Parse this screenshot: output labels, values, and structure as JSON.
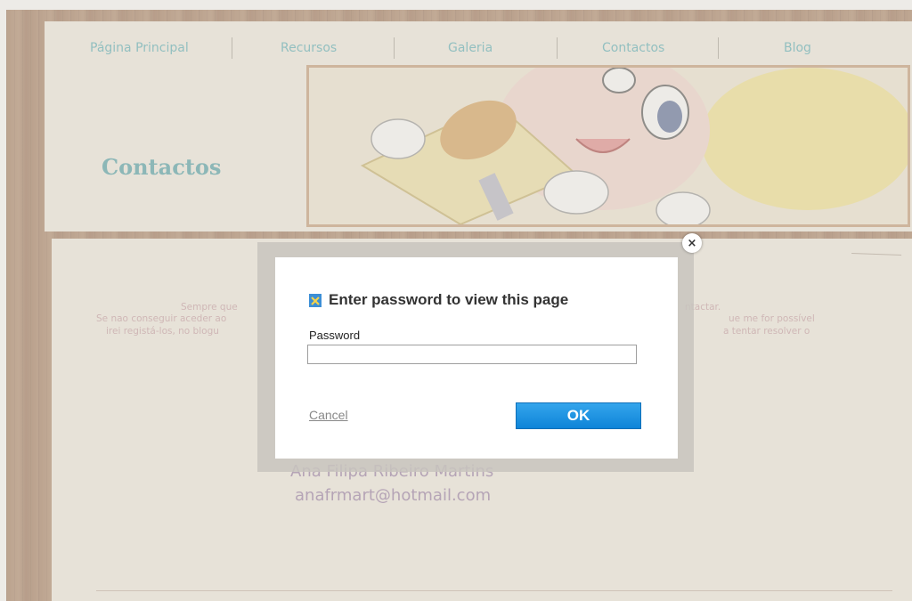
{
  "nav": {
    "items": [
      "Página Principal",
      "Recursos",
      "Galeria",
      "Contactos",
      "Blog"
    ]
  },
  "page": {
    "heading": "Contactos"
  },
  "content": {
    "line1_left": "Sempre que",
    "line1_right": "ntactar.",
    "line2_left": "Se nao conseguir aceder ao",
    "line2_right": "ue me for possível",
    "line3_left": "irei registá-los, no blogu",
    "line3_right": "a tentar resolver o",
    "contact_name": "Ana Filipa Ribeiro Martins",
    "contact_email": "anafrmart@hotmail.com"
  },
  "modal": {
    "title": "Enter password to view this page",
    "password_label": "Password",
    "password_value": "",
    "cancel_label": "Cancel",
    "ok_label": "OK",
    "close_symbol": "×"
  },
  "colors": {
    "nav_text": "#5ab0b8",
    "heading": "#4fa0a8",
    "ok_button": "#0e84d8"
  }
}
